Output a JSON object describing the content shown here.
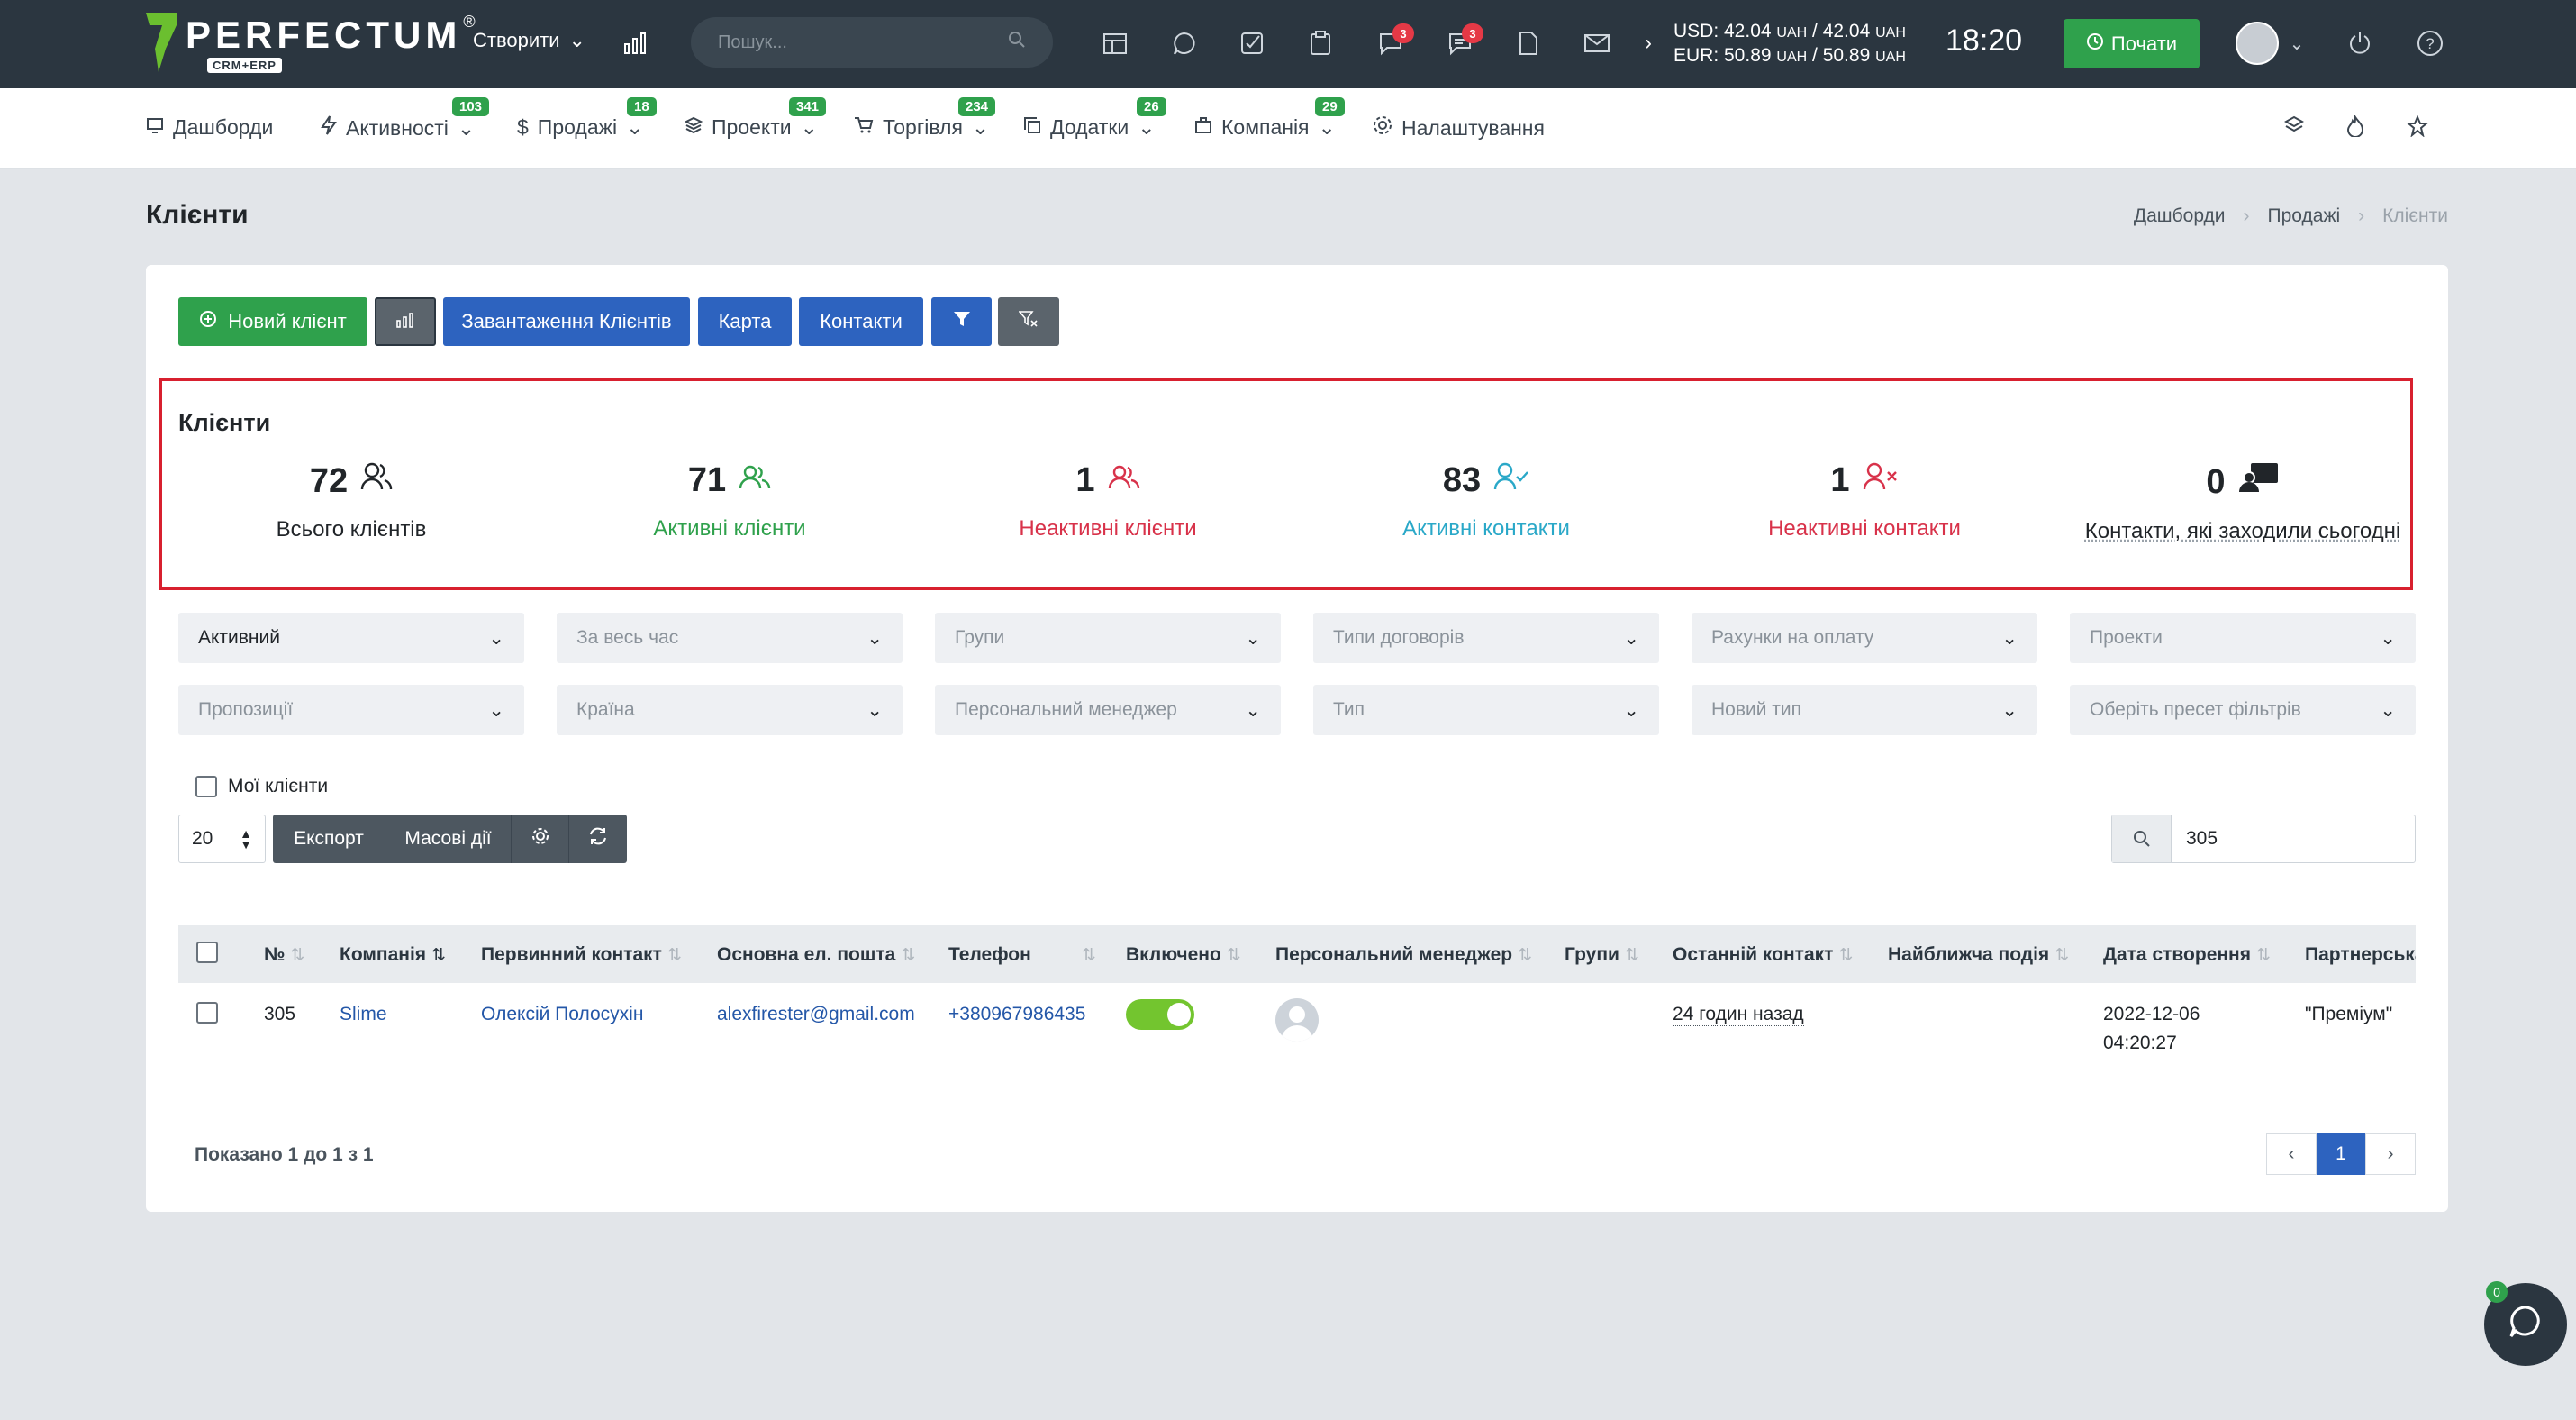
{
  "topbar": {
    "logo_text": "PERFECTUM",
    "logo_reg": "®",
    "logo_sub": "CRM+ERP",
    "create_label": "Створити",
    "search_placeholder": "Пошук...",
    "badges": {
      "chat1": "3",
      "chat2": "3"
    },
    "currency_usd": "USD: 42.04",
    "currency_usd_rest": "/ 42.04",
    "currency_eur": "EUR: 50.89",
    "currency_eur_rest": "/ 50.89",
    "currency_unit": "UAH",
    "time": "18:20",
    "start_label": "Почати"
  },
  "nav": {
    "items": [
      {
        "label": "Дашборди",
        "icon": "monitor-icon"
      },
      {
        "label": "Активності",
        "badge": "103",
        "icon": "bolt-icon"
      },
      {
        "label": "Продажі",
        "badge": "18",
        "icon": "dollar-icon"
      },
      {
        "label": "Проекти",
        "badge": "341",
        "icon": "layers-icon"
      },
      {
        "label": "Торгівля",
        "badge": "234",
        "icon": "cart-icon"
      },
      {
        "label": "Додатки",
        "badge": "26",
        "icon": "copy-icon"
      },
      {
        "label": "Компанія",
        "badge": "29",
        "icon": "briefcase-icon"
      },
      {
        "label": "Налаштування",
        "icon": "gear-icon"
      }
    ]
  },
  "page": {
    "title": "Клієнти",
    "breadcrumb": [
      "Дашборди",
      "Продажі",
      "Клієнти"
    ]
  },
  "toolbar": {
    "new_client": "Новий клієнт",
    "upload_clients": "Завантаження Клієнтів",
    "map": "Карта",
    "contacts": "Контакти"
  },
  "stats": {
    "title": "Клієнти",
    "items": [
      {
        "value": "72",
        "label": "Всього клієнтів",
        "color": "#212529"
      },
      {
        "value": "71",
        "label": "Активні клієнти",
        "color": "#2fa14c"
      },
      {
        "value": "1",
        "label": "Неактивні клієнти",
        "color": "#d8202f"
      },
      {
        "value": "83",
        "label": "Активні контакти",
        "color": "#2aa8c8"
      },
      {
        "value": "1",
        "label": "Неактивні контакти",
        "color": "#d8324a"
      },
      {
        "value": "0",
        "label": "Контакти, які заходили сьогодні",
        "color": "#212529"
      }
    ]
  },
  "filters": {
    "row1": [
      "Активний",
      "За весь час",
      "Групи",
      "Типи договорів",
      "Рахунки на оплату",
      "Проекти"
    ],
    "row2": [
      "Пропозиції",
      "Країна",
      "Персональний менеджер",
      "Тип",
      "Новий тип",
      "Оберіть пресет фільтрів"
    ]
  },
  "my_clients_label": "Мої клієнти",
  "table_controls": {
    "page_size": "20",
    "export": "Експорт",
    "bulk": "Масові дії",
    "search_value": "305"
  },
  "table": {
    "headers": [
      "№",
      "Компанія",
      "Первинний контакт",
      "Основна ел. пошта",
      "Телефон",
      "Включено",
      "Персональний менеджер",
      "Групи",
      "Останній контакт",
      "Найближча подія",
      "Дата створення",
      "Партнерська"
    ],
    "row": {
      "num": "305",
      "company": "Slime",
      "contact": "Олексій Полосухін",
      "email": "alexfirester@gmail.com",
      "phone": "+380967986435",
      "enabled": true,
      "last_contact": "24 годин назад",
      "created_date": "2022-12-06",
      "created_time": "04:20:27",
      "partner": "\"Преміум\""
    }
  },
  "footer": {
    "shown": "Показано 1 до 1 з 1",
    "page": "1"
  },
  "chat_badge": "0"
}
